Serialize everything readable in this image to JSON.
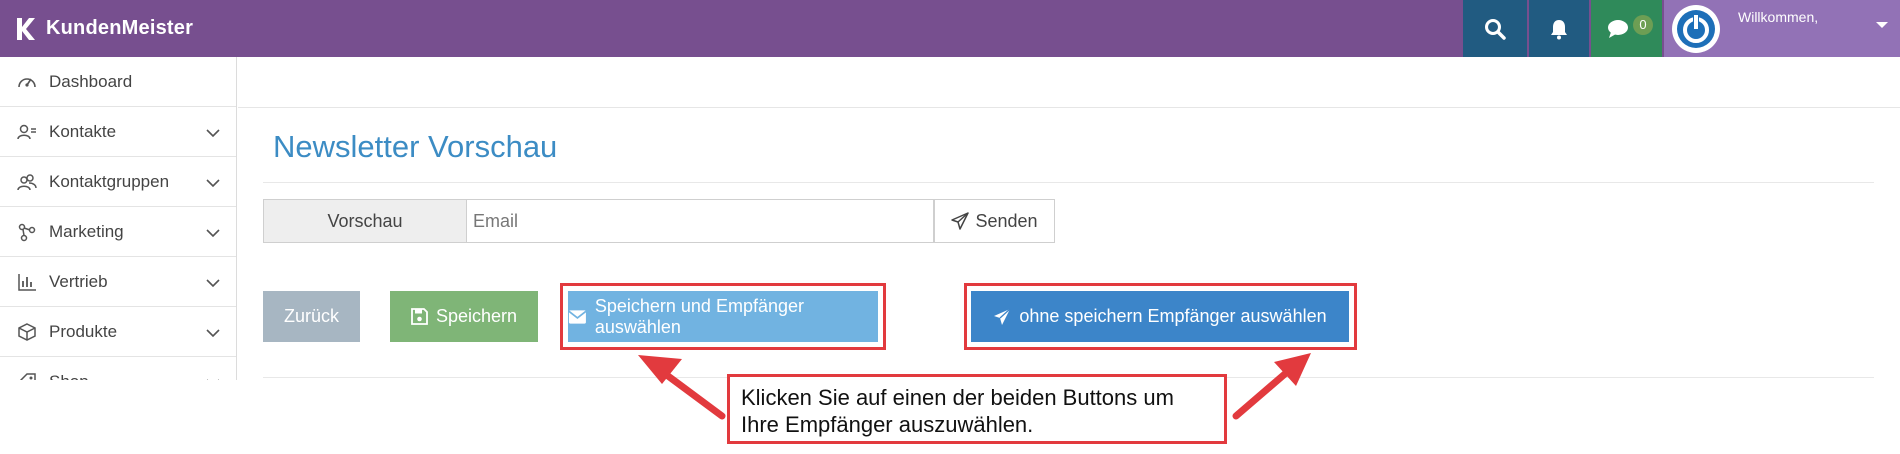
{
  "brand": {
    "name": "KundenMeister"
  },
  "topbar": {
    "chat_count": "0",
    "welcome": "Willkommen,"
  },
  "sidebar": {
    "items": [
      {
        "label": "Dashboard",
        "icon": "gauge-icon",
        "expandable": false
      },
      {
        "label": "Kontakte",
        "icon": "user-list-icon",
        "expandable": true
      },
      {
        "label": "Kontaktgruppen",
        "icon": "users-icon",
        "expandable": true
      },
      {
        "label": "Marketing",
        "icon": "network-icon",
        "expandable": true
      },
      {
        "label": "Vertrieb",
        "icon": "bar-chart-icon",
        "expandable": true
      },
      {
        "label": "Produkte",
        "icon": "box-icon",
        "expandable": true
      },
      {
        "label": "Shop",
        "icon": "tag-icon",
        "expandable": true
      }
    ]
  },
  "page": {
    "title": "Newsletter Vorschau",
    "preview_label": "Vorschau",
    "email_placeholder": "Email",
    "send_label": "Senden"
  },
  "actions": {
    "back": "Zurück",
    "save": "Speichern",
    "save_and_select": "Speichern und Empfänger auswählen",
    "select_without_save": "ohne speichern Empfänger auswählen"
  },
  "annotation": {
    "line1": "Klicken Sie auf einen der beiden Buttons um",
    "line2": "Ihre Empfänger auszuwählen."
  },
  "colors": {
    "topbar": "#774f8f",
    "accent_title": "#3c8cc4",
    "highlight": "#e23a3e",
    "back_btn": "#a7b6c2",
    "save_btn": "#7fb577",
    "save_select_btn": "#71b3e1",
    "select_btn": "#3c85c9"
  }
}
